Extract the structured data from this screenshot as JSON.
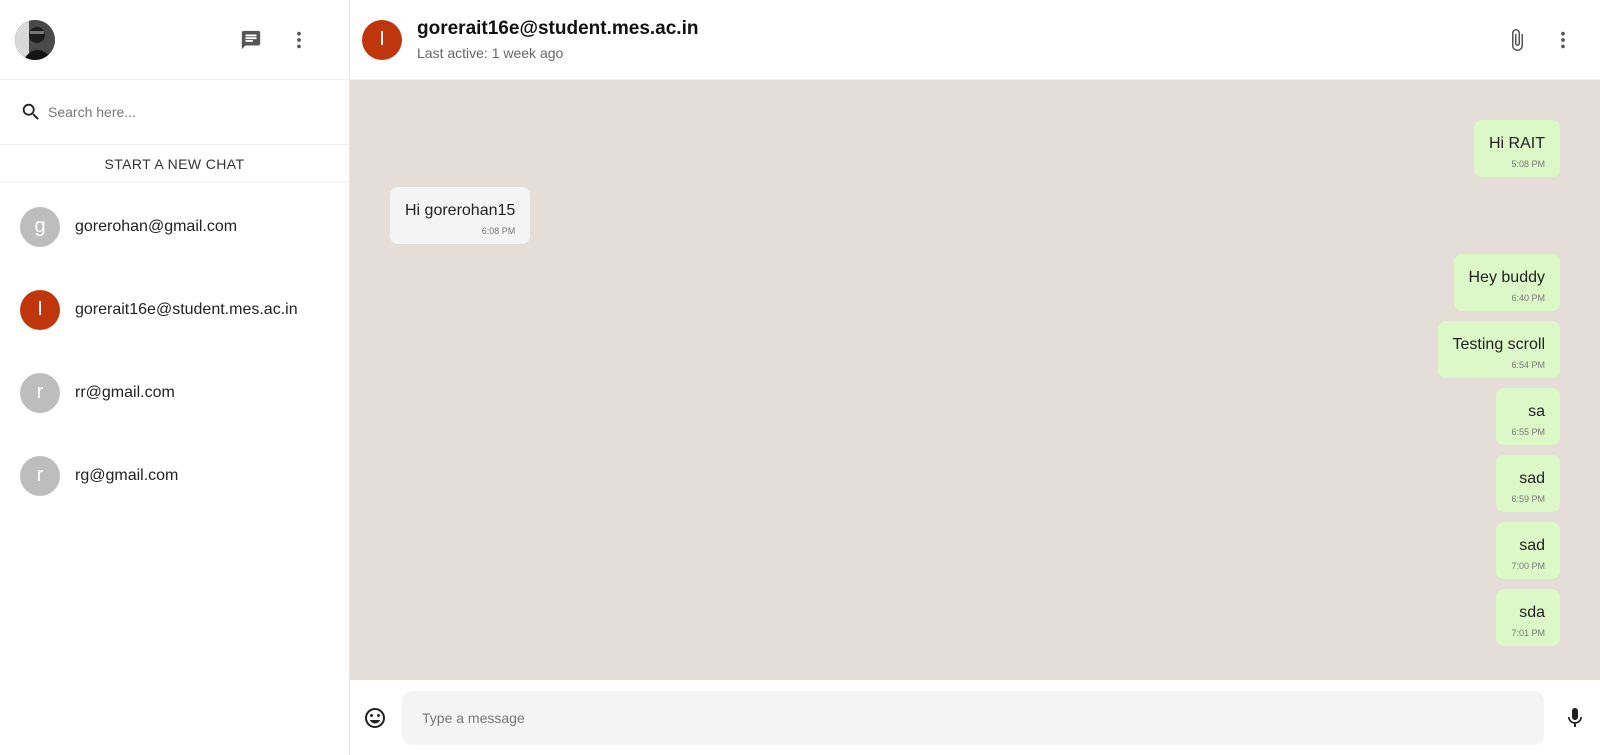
{
  "sidebar": {
    "user_avatar_icon": "user-photo",
    "new_message_icon": "chat-icon",
    "menu_icon": "more-vert-icon",
    "search": {
      "placeholder": "Search here..."
    },
    "new_chat_label": "START A NEW CHAT",
    "chats": [
      {
        "initial": "g",
        "name": "gorerohan@gmail.com",
        "active": false
      },
      {
        "initial": "I",
        "name": "gorerait16e@student.mes.ac.in",
        "active": true
      },
      {
        "initial": "r",
        "name": "rr@gmail.com",
        "active": false
      },
      {
        "initial": "r",
        "name": "rg@gmail.com",
        "active": false
      }
    ]
  },
  "header": {
    "avatar_initial": "I",
    "title": "gorerait16e@student.mes.ac.in",
    "subtitle": "Last active: 1 week ago",
    "icons": [
      "attach-icon",
      "more-vert-icon"
    ]
  },
  "messages": [
    {
      "from": "me",
      "text": "Hi RAIT",
      "time": "5:08 PM"
    },
    {
      "from": "them",
      "text": "Hi gorerohan15",
      "time": "6:08 PM"
    },
    {
      "from": "me",
      "text": "Hey buddy",
      "time": "6:40 PM"
    },
    {
      "from": "me",
      "text": "Testing scroll",
      "time": "6:54 PM"
    },
    {
      "from": "me",
      "text": "sa",
      "time": "6:55 PM"
    },
    {
      "from": "me",
      "text": "sad",
      "time": "6:59 PM"
    },
    {
      "from": "me",
      "text": "sad",
      "time": "7:00 PM"
    },
    {
      "from": "me",
      "text": "sda",
      "time": "7:01 PM"
    }
  ],
  "footer": {
    "placeholder": "Type a message",
    "icons": [
      "emoji-icon",
      "mic-icon"
    ]
  },
  "colors": {
    "accent_avatar": "#bf360c",
    "chat_background": "#e5ded8",
    "my_bubble": "#dcf8c6",
    "their_bubble": "#f4f4f4"
  }
}
